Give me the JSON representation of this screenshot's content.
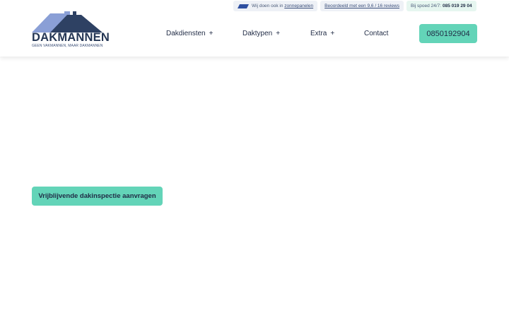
{
  "header": {
    "logo": {
      "wordmark": "DAKMANNEN",
      "tagline": "GEEN VAKMANNEN, MAAR DAKMANNEN"
    },
    "topbar": {
      "solar_prefix": "Wij doen ook in",
      "solar_link": "zonnepanelen",
      "rating_link": "Beoordeeld met een 9,6 / 16 reviews",
      "emergency_label": "Bij spoed 24/7:",
      "emergency_number": "085 019 29 04"
    },
    "nav": [
      {
        "label": "Dakdiensten",
        "has_submenu": true
      },
      {
        "label": "Daktypen",
        "has_submenu": true
      },
      {
        "label": "Extra",
        "has_submenu": true
      },
      {
        "label": "Contact",
        "has_submenu": false
      }
    ],
    "plus_glyph": "+",
    "phone_button": "0850192904"
  },
  "main": {
    "cta_button": "Vrijblijvende dakinspectie aanvragen"
  },
  "colors": {
    "accent": "#63d4b8",
    "navy": "#243654",
    "roof_light": "#8a9fd6"
  }
}
